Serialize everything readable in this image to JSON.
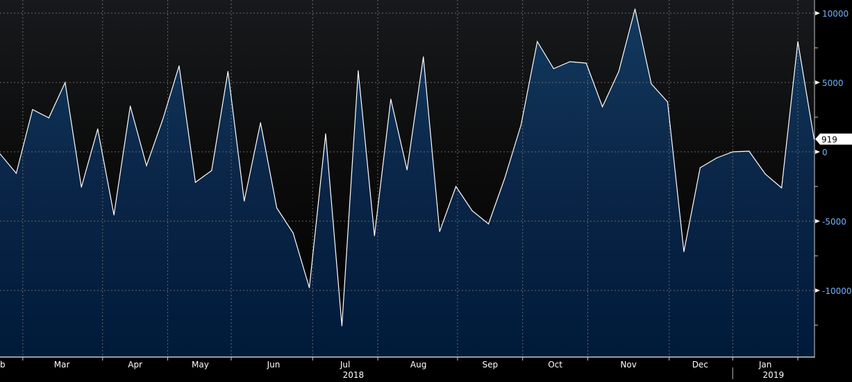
{
  "chart_data": {
    "type": "area",
    "title": "",
    "xlabel": "",
    "ylabel": "",
    "ylim": [
      -14750,
      10950
    ],
    "grid": true,
    "x_index_range": [
      0,
      49
    ],
    "values": [
      -150,
      -1550,
      3050,
      2450,
      5000,
      -2550,
      1650,
      -4550,
      3300,
      -1000,
      2350,
      6200,
      -2200,
      -1350,
      5800,
      -3550,
      2100,
      -4050,
      -5850,
      -9800,
      1300,
      -12550,
      5850,
      -6050,
      3800,
      -1300,
      6850,
      -5750,
      -2500,
      -4250,
      -5200,
      -1900,
      1950,
      7950,
      6000,
      6500,
      6400,
      3250,
      5800,
      10300,
      4900,
      3600,
      -7200,
      -1150,
      -450,
      0,
      50,
      -1600,
      -2600,
      7950,
      919
    ],
    "y_ticks": [
      {
        "value": 10000,
        "label": "10000"
      },
      {
        "value": 5000,
        "label": "5000"
      },
      {
        "value": 0,
        "label": "0"
      },
      {
        "value": -5000,
        "label": "-5000"
      },
      {
        "value": -10000,
        "label": "-10000"
      }
    ],
    "y_minor_ticks": [
      7500,
      2500,
      -2500,
      -7500,
      -12500
    ],
    "month_boundaries": [
      1.4,
      6.3,
      10.3,
      14.2,
      19.2,
      23.2,
      28.1,
      32.1,
      36.1,
      41.1,
      45.0,
      49.0
    ],
    "x_month_labels": [
      {
        "label": "b",
        "at": -0.1
      },
      {
        "label": "Mar",
        "at": 3.8
      },
      {
        "label": "Apr",
        "at": 8.3
      },
      {
        "label": "May",
        "at": 12.3
      },
      {
        "label": "Jun",
        "at": 16.8
      },
      {
        "label": "Jul",
        "at": 21.2
      },
      {
        "label": "Aug",
        "at": 25.7
      },
      {
        "label": "Sep",
        "at": 30.1
      },
      {
        "label": "Oct",
        "at": 34.1
      },
      {
        "label": "Nov",
        "at": 38.6
      },
      {
        "label": "Dec",
        "at": 43.0
      },
      {
        "label": "Jan",
        "at": 47.0
      }
    ],
    "x_year_labels": [
      {
        "label": "2018",
        "at": 21.7
      },
      {
        "label": "2019",
        "at": 47.5
      }
    ],
    "year_boundary": 45.0,
    "last_value_label": "919",
    "colors": {
      "line": "#ffffff",
      "fill_top": "#0d3355",
      "fill_bottom": "#00183a",
      "axis_text": "#ffffff",
      "tick_text": "#6fb4ff"
    }
  }
}
